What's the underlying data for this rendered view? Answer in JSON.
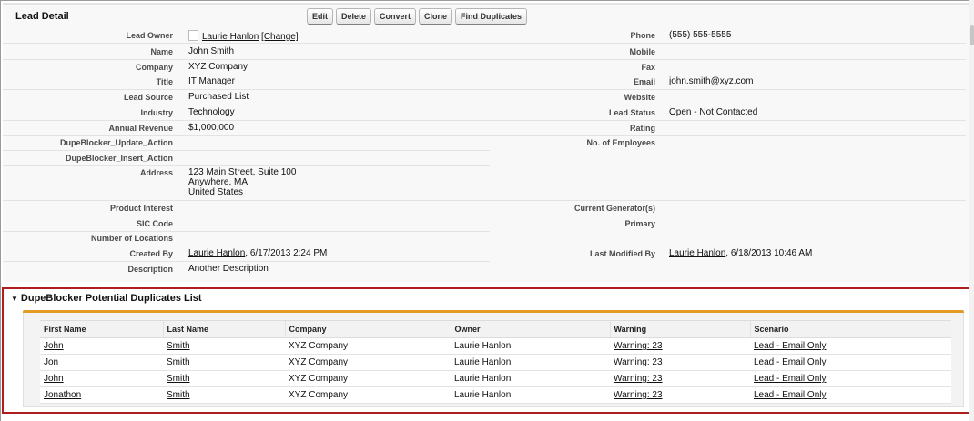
{
  "detail": {
    "title": "Lead Detail",
    "buttons": [
      "Edit",
      "Delete",
      "Convert",
      "Clone",
      "Find Duplicates"
    ],
    "left_fields": [
      {
        "label": "Lead Owner",
        "value": "Laurie Hanlon",
        "extra": "[Change]"
      },
      {
        "label": "Name",
        "value": "John Smith"
      },
      {
        "label": "Company",
        "value": "XYZ Company"
      },
      {
        "label": "Title",
        "value": "IT Manager"
      },
      {
        "label": "Lead Source",
        "value": "Purchased List"
      },
      {
        "label": "Industry",
        "value": "Technology"
      },
      {
        "label": "Annual Revenue",
        "value": "$1,000,000"
      },
      {
        "label": "DupeBlocker_Update_Action",
        "value": ""
      },
      {
        "label": "DupeBlocker_Insert_Action",
        "value": ""
      },
      {
        "label": "Address",
        "line1": "123 Main Street, Suite 100",
        "line2": "Anywhere, MA",
        "line3": "United States"
      },
      {
        "label": "Product Interest",
        "value": ""
      },
      {
        "label": "SIC Code",
        "value": ""
      },
      {
        "label": "Number of Locations",
        "value": ""
      },
      {
        "label": "Created By",
        "value": "Laurie Hanlon",
        "extra": ", 6/17/2013 2:24 PM"
      },
      {
        "label": "Description",
        "value": "Another Description"
      }
    ],
    "right_fields": [
      {
        "label": "Phone",
        "value": "(555) 555-5555"
      },
      {
        "label": "Mobile",
        "value": ""
      },
      {
        "label": "Fax",
        "value": ""
      },
      {
        "label": "Email",
        "value": "john.smith@xyz.com"
      },
      {
        "label": "Website",
        "value": ""
      },
      {
        "label": "Lead Status",
        "value": "Open - Not Contacted"
      },
      {
        "label": "Rating",
        "value": ""
      },
      {
        "label": "No. of Employees",
        "value": ""
      },
      {
        "label": "Current Generator(s)",
        "value": ""
      },
      {
        "label": "Primary",
        "value": ""
      },
      {
        "label": "Last Modified By",
        "value": "Laurie Hanlon",
        "extra": ", 6/18/2013 10:46 AM"
      }
    ]
  },
  "duplicates": {
    "title": "DupeBlocker Potential Duplicates List",
    "columns": [
      "First Name",
      "Last Name",
      "Company",
      "Owner",
      "Warning",
      "Scenario"
    ],
    "rows": [
      [
        "John",
        "Smith",
        "XYZ Company",
        "Laurie Hanlon",
        "Warning: 23",
        "Lead - Email Only"
      ],
      [
        "Jon",
        "Smith",
        "XYZ Company",
        "Laurie Hanlon",
        "Warning: 23",
        "Lead - Email Only"
      ],
      [
        "John",
        "Smith",
        "XYZ Company",
        "Laurie Hanlon",
        "Warning: 23",
        "Lead - Email Only"
      ],
      [
        "Jonathon",
        "Smith",
        "XYZ Company",
        "Laurie Hanlon",
        "Warning: 23",
        "Lead - Email Only"
      ]
    ]
  },
  "colors": {
    "highlight_border": "#b01e1e",
    "accent_bar": "#e39b26"
  }
}
